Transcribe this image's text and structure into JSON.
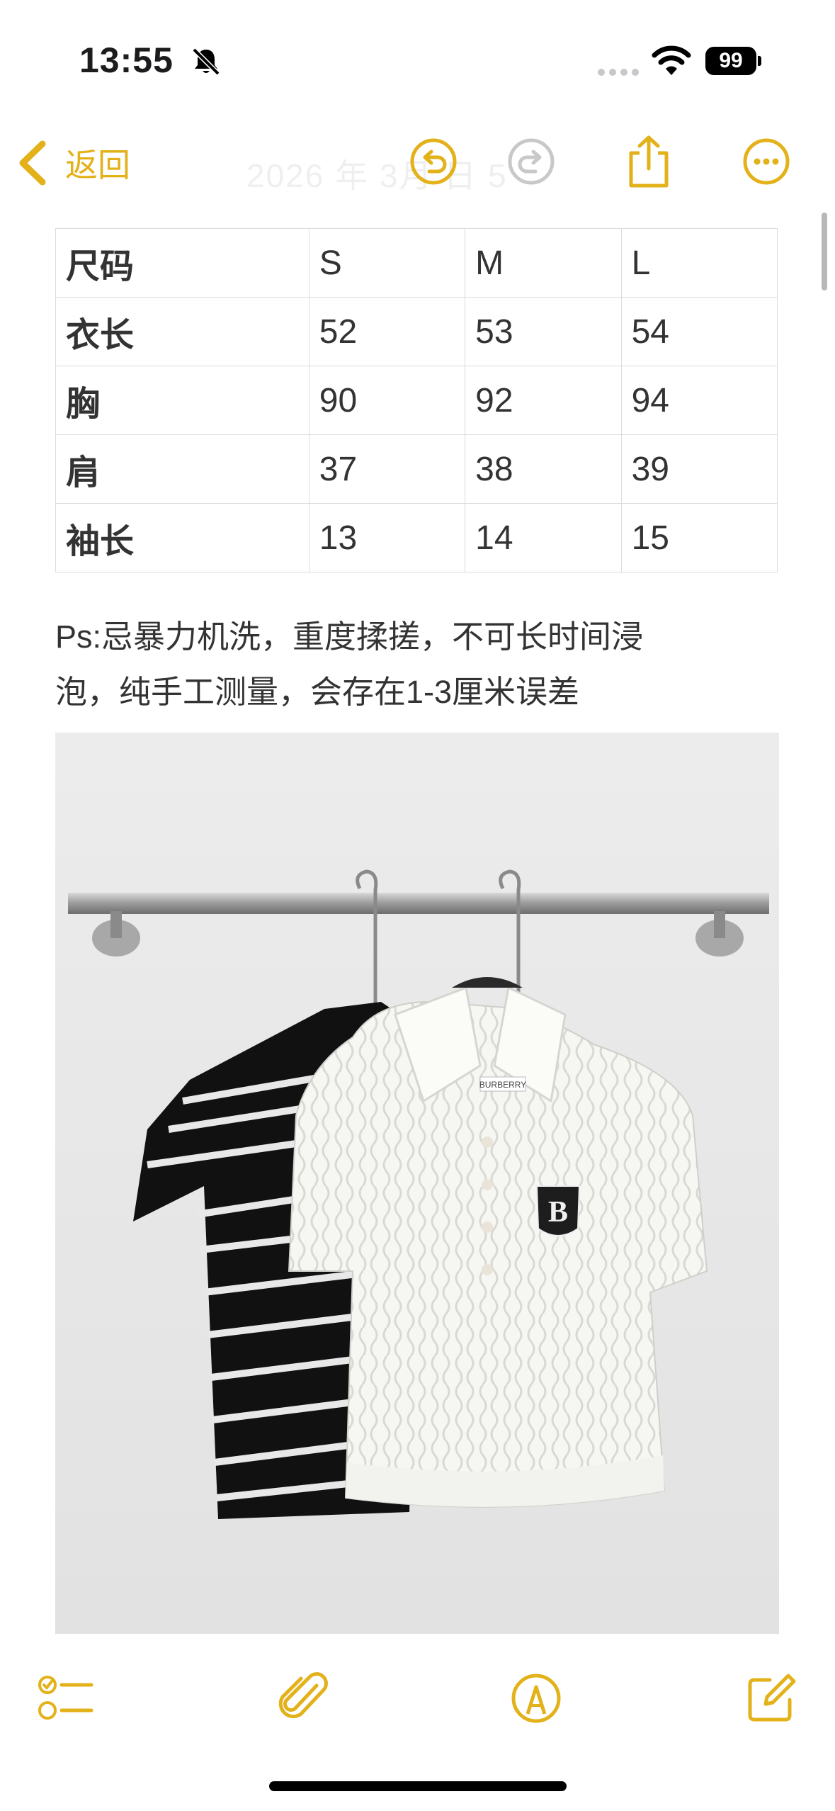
{
  "status_bar": {
    "time": "13:55",
    "battery": "99"
  },
  "nav": {
    "back_label": "返回",
    "title": "2026 年 3月 日 5",
    "accent_color": "#e3b119",
    "icons": [
      "undo-icon",
      "redo-icon",
      "share-icon",
      "more-icon"
    ]
  },
  "size_table": {
    "rows": [
      [
        "尺码",
        "S",
        "M",
        "L"
      ],
      [
        "衣长",
        "52",
        "53",
        "54"
      ],
      [
        "胸",
        "90",
        "92",
        "94"
      ],
      [
        "肩",
        "37",
        "38",
        "39"
      ],
      [
        "袖长",
        "13",
        "14",
        "15"
      ]
    ]
  },
  "note": {
    "line1": "Ps:忌暴力机洗，重度揉搓，不可长时间浸",
    "line2": "泡，纯手工测量，会存在1-3厘米误差"
  },
  "photo": {
    "label": "BURBERRY"
  },
  "toolbar": {
    "icons": [
      "checklist-icon",
      "attachment-icon",
      "markup-icon",
      "compose-icon"
    ]
  }
}
